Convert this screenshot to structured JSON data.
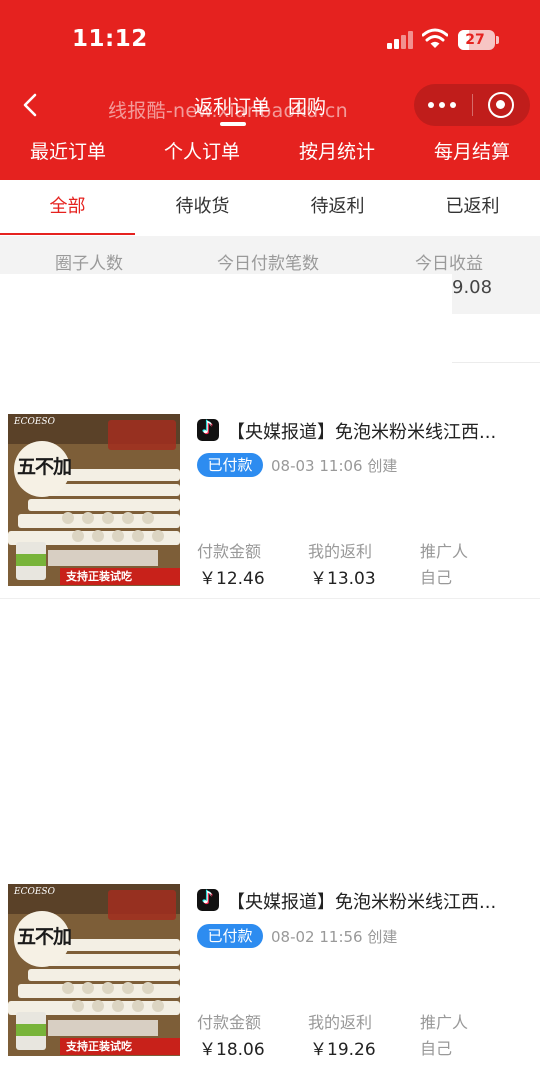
{
  "status_bar": {
    "time": "11:12",
    "battery": "27"
  },
  "watermark": "线报酷-new.xianbaoku.cn",
  "nav": {
    "title_tabs": [
      "返利订单",
      "团购"
    ]
  },
  "main_tabs": [
    "最近订单",
    "个人订单",
    "按月统计",
    "每月结算"
  ],
  "sub_tabs": [
    "全部",
    "待收货",
    "待返利",
    "已返利"
  ],
  "stats": {
    "labels": [
      "圈子人数",
      "今日付款笔数",
      "今日收益"
    ],
    "visible_value": "9.08"
  },
  "orders": [
    {
      "title": "【央媒报道】免泡米粉米线江西...",
      "status": "已付款",
      "created": "08-03 11:06 创建",
      "pay_label": "付款金额",
      "pay_amount": "￥12.46",
      "rebate_label": "我的返利",
      "rebate_amount": "￥13.03",
      "promoter_label": "推广人",
      "promoter": "自己",
      "thumb": {
        "brand": "ECOESO",
        "headline": "五不加",
        "banner": "支持正装试吃"
      }
    },
    {
      "title": "【央媒报道】免泡米粉米线江西...",
      "status": "已付款",
      "created": "08-02 11:56 创建",
      "pay_label": "付款金额",
      "pay_amount": "￥18.06",
      "rebate_label": "我的返利",
      "rebate_amount": "￥19.26",
      "promoter_label": "推广人",
      "promoter": "自己",
      "thumb": {
        "brand": "ECOESO",
        "headline": "五不加",
        "banner": "支持正装试吃"
      }
    }
  ]
}
